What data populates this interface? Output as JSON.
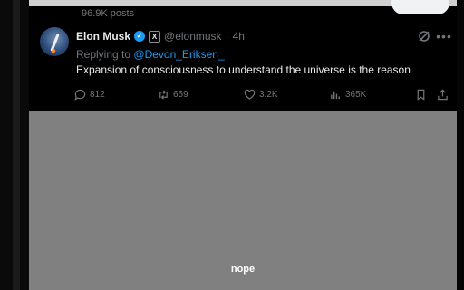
{
  "previous_post": {
    "posts_count": "96.9K posts"
  },
  "tweet": {
    "author_name": "Elon Musk",
    "handle": "@elonmusk",
    "separator": "·",
    "time": "4h",
    "badge_label": "X",
    "replying_prefix": "Replying to",
    "replying_to": "@Devon_Eriksen_",
    "text": "Expansion of consciousness to understand the universe is the reason",
    "stats": {
      "replies": "812",
      "reposts": "659",
      "likes": "3.2K",
      "views": "365K"
    }
  },
  "overlay": {
    "label": "nope"
  },
  "icons": {
    "verified": "verified-badge-icon",
    "grok": "grok-icon",
    "more": "more-icon",
    "reply": "reply-icon",
    "repost": "repost-icon",
    "like": "heart-icon",
    "views": "views-icon",
    "bookmark": "bookmark-icon",
    "share": "share-icon"
  },
  "colors": {
    "accent": "#1d9bf0",
    "muted": "#71767b",
    "text": "#e7e9ea",
    "overlay": "#808080",
    "background": "#000000"
  }
}
